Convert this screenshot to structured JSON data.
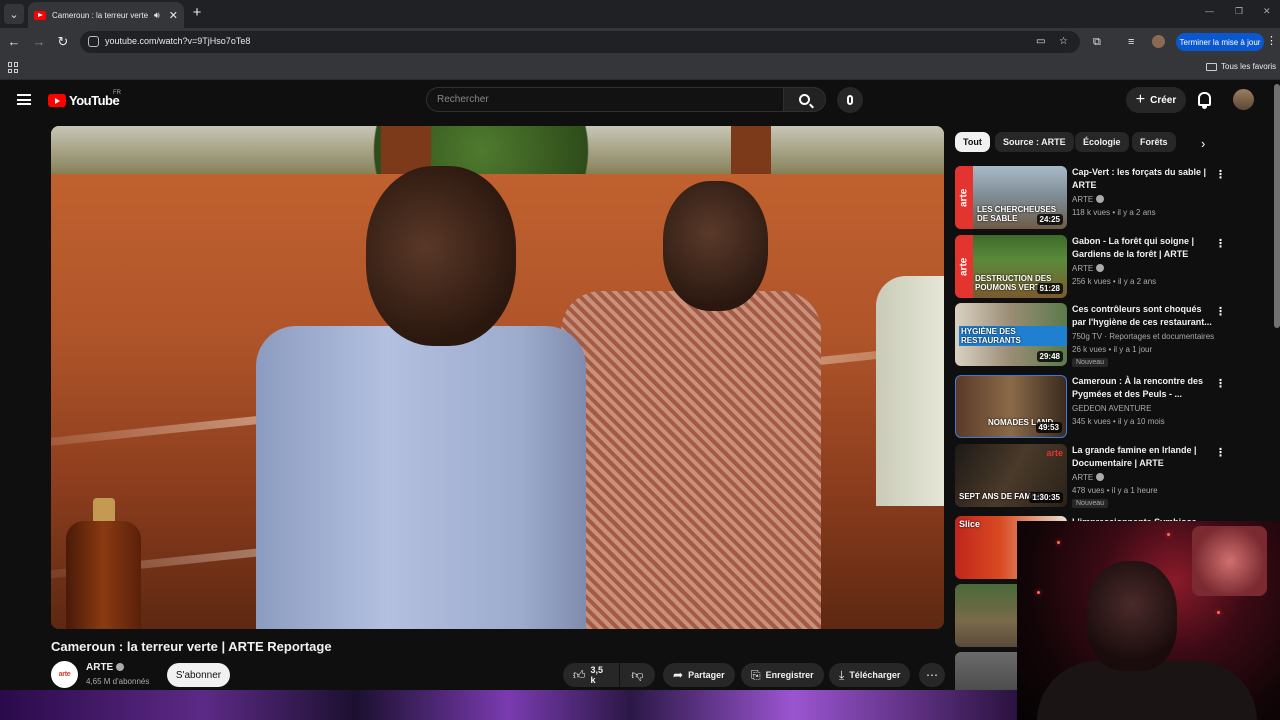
{
  "browser": {
    "tab_title": "Cameroun : la terreur verte | ARTE Reportage",
    "url": "youtube.com/watch?v=9TjHso7oTe8",
    "update_label": "Terminer la mise à jour",
    "bookmarks_label": "Tous les favoris"
  },
  "masthead": {
    "logo_text": "YouTube",
    "country_code": "FR",
    "search_placeholder": "Rechercher",
    "create_label": "Créer"
  },
  "video": {
    "title": "Cameroun : la terreur verte | ARTE Reportage",
    "channel": "ARTE",
    "channel_avatar_text": "arte",
    "subscribers": "4,65 M d'abonnés",
    "subscribe_label": "S'abonner",
    "likes": "3,5 k",
    "share_label": "Partager",
    "save_label": "Enregistrer",
    "download_label": "Télécharger"
  },
  "chips": [
    "Tout",
    "Source : ARTE",
    "Écologie",
    "Forêts"
  ],
  "recommendations": [
    {
      "title": "Cap-Vert : les forçats du sable | ARTE",
      "channel": "ARTE",
      "verified": true,
      "meta": "118 k vues • il y a 2 ans",
      "duration": "24:25",
      "caption": "LES CHERCHEUSES DE SABLE",
      "is_new": false
    },
    {
      "title": "Gabon - La forêt qui soigne | Gardiens de la forêt | ARTE",
      "channel": "ARTE",
      "verified": true,
      "meta": "256 k vues • il y a 2 ans",
      "duration": "51:28",
      "caption": "DESTRUCTION DES POUMONS VERTS",
      "is_new": false
    },
    {
      "title": "Ces contrôleurs sont choqués par l'hygiène de ces restaurant...",
      "channel": "750g TV · Reportages et documentaires",
      "verified": false,
      "meta": "26 k vues • il y a 1 jour",
      "duration": "29:48",
      "caption": "HYGIÈNE DES RESTAURANTS",
      "is_new": true
    },
    {
      "title": "Cameroun : À la rencontre des Pygmées et des Peuls - ...",
      "channel": "GEDEON AVENTURE",
      "verified": false,
      "meta": "345 k vues • il y a 10 mois",
      "duration": "49:53",
      "caption": "NOMADES LAND",
      "is_new": false
    },
    {
      "title": "La grande famine en Irlande | Documentaire | ARTE",
      "channel": "ARTE",
      "verified": true,
      "meta": "478 vues • il y a 1 heure",
      "duration": "1:30:35",
      "caption": "SEPT ANS DE FAMINE",
      "is_new": true
    },
    {
      "title": "L'impressionnante Symbiose du...",
      "channel": "",
      "verified": false,
      "meta": "",
      "duration": "",
      "caption": "Slice",
      "is_new": false
    }
  ],
  "labels": {
    "new_badge": "Nouveau"
  },
  "colors": {
    "youtube_red": "#ff0000",
    "arte_red": "#e3342f",
    "update_blue": "#0b57d0"
  }
}
